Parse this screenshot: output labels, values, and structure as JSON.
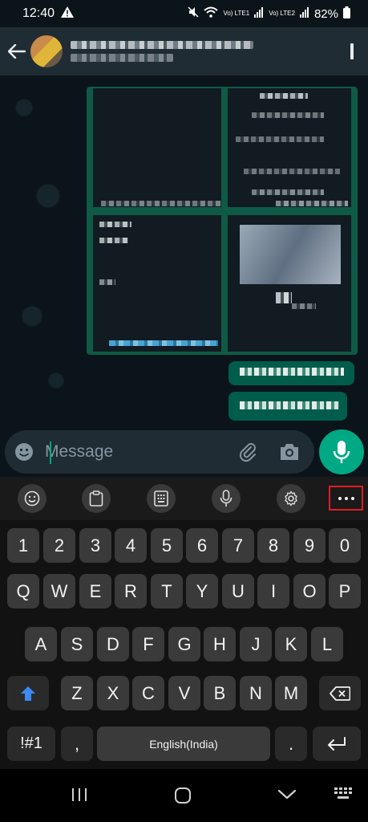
{
  "status_bar": {
    "time": "12:40",
    "battery": "82%",
    "volte1": "Vo) LTE1",
    "volte2": "Vo) LTE2"
  },
  "message_input": {
    "placeholder": "Message"
  },
  "keyboard": {
    "number_row": [
      "1",
      "2",
      "3",
      "4",
      "5",
      "6",
      "7",
      "8",
      "9",
      "0"
    ],
    "row1": [
      "Q",
      "W",
      "E",
      "R",
      "T",
      "Y",
      "U",
      "I",
      "O",
      "P"
    ],
    "row2": [
      "A",
      "S",
      "D",
      "F",
      "G",
      "H",
      "J",
      "K",
      "L"
    ],
    "row3": [
      "Z",
      "X",
      "C",
      "V",
      "B",
      "N",
      "M"
    ],
    "symbols_key": "!#1",
    "comma_key": ",",
    "space_label": "English(India)",
    "period_key": "."
  },
  "colors": {
    "accent": "#00a884",
    "highlight_box": "#e01b24",
    "header_bg": "#1f2c34"
  }
}
